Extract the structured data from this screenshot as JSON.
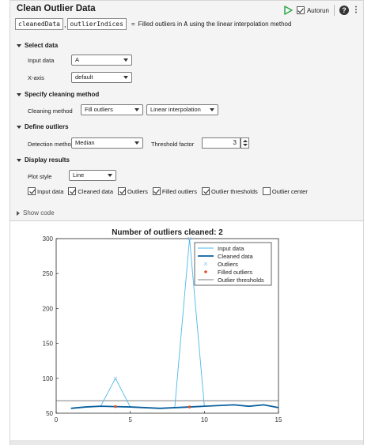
{
  "header": {
    "title": "Clean Outlier Data",
    "autorun_label": "Autorun",
    "help_glyph": "?",
    "more_glyph": "⋮",
    "outputs": [
      "cleanedData",
      "outlierIndices"
    ],
    "equals": "=",
    "description_pre": "Filled outliers in ",
    "description_var": "A",
    "description_post": " using the linear interpolation method"
  },
  "sections": {
    "select_data": "Select data",
    "specify_method": "Specify cleaning method",
    "define_outliers": "Define outliers",
    "display_results": "Display results"
  },
  "select_data": {
    "input_label": "Input data",
    "input_value": "A",
    "xaxis_label": "X-axis",
    "xaxis_value": "default"
  },
  "method": {
    "label": "Cleaning method",
    "value": "Fill outliers",
    "fill_value": "Linear interpolation"
  },
  "outliers": {
    "detection_label": "Detection method",
    "detection_value": "Median",
    "threshold_label": "Threshold factor",
    "threshold_value": "3"
  },
  "display": {
    "plot_style_label": "Plot style",
    "plot_style_value": "Line",
    "checkboxes": [
      {
        "label": "Input data",
        "checked": true
      },
      {
        "label": "Cleaned data",
        "checked": true
      },
      {
        "label": "Outliers",
        "checked": true
      },
      {
        "label": "Filled outliers",
        "checked": true
      },
      {
        "label": "Outlier thresholds",
        "checked": true
      },
      {
        "label": "Outlier center",
        "checked": false
      }
    ]
  },
  "show_code_label": "Show code",
  "colors": {
    "input": "#4db8e8",
    "cleaned": "#0b5f9e",
    "outliers": "#9ec7e8",
    "filled": "#d9532b",
    "thresholds": "#555555",
    "run": "#2ea84a"
  },
  "chart_data": {
    "type": "line",
    "title": "Number of outliers cleaned: 2",
    "xlabel": "",
    "ylabel": "",
    "xlim": [
      0,
      15
    ],
    "ylim": [
      50,
      300
    ],
    "xticks": [
      0,
      5,
      10,
      15
    ],
    "yticks": [
      50,
      100,
      150,
      200,
      250,
      300
    ],
    "legend_position": "top-right",
    "legend": [
      "Input data",
      "Cleaned data",
      "Outliers",
      "Filled outliers",
      "Outlier thresholds"
    ],
    "series": [
      {
        "name": "Input data",
        "x": [
          1,
          2,
          3,
          4,
          5,
          6,
          7,
          8,
          9,
          10,
          11,
          12,
          13,
          14,
          15
        ],
        "y": [
          57,
          59,
          60,
          100,
          59,
          58,
          57,
          58,
          300,
          60,
          61,
          62,
          60,
          62,
          58
        ]
      },
      {
        "name": "Cleaned data",
        "x": [
          1,
          2,
          3,
          4,
          5,
          6,
          7,
          8,
          9,
          10,
          11,
          12,
          13,
          14,
          15
        ],
        "y": [
          57,
          59,
          60,
          59.5,
          59,
          58,
          57,
          58,
          59,
          60,
          61,
          62,
          60,
          62,
          58
        ]
      },
      {
        "name": "Outliers",
        "x": [
          4,
          9
        ],
        "y": [
          100,
          300
        ]
      },
      {
        "name": "Filled outliers",
        "x": [
          4,
          9
        ],
        "y": [
          59.5,
          59
        ]
      },
      {
        "name": "Outlier thresholds",
        "x": [
          0,
          15
        ],
        "y": [
          68,
          68
        ]
      }
    ]
  }
}
